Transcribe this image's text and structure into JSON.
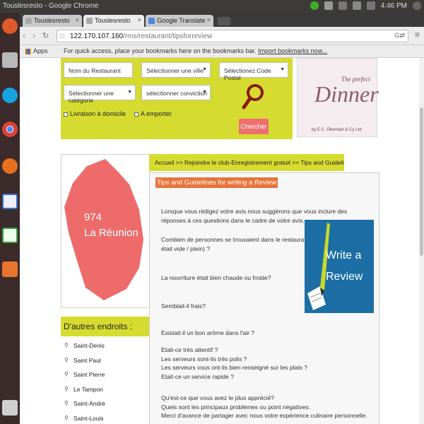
{
  "os": {
    "window_title": "Touslesresto - Google Chrome",
    "time": "4:46 PM",
    "user": "Person 1"
  },
  "launcher": {
    "items": [
      "ubuntu-dash-icon",
      "files-icon",
      "skype-icon",
      "chrome-icon",
      "firefox-icon",
      "writer-icon",
      "calc-icon",
      "software-center-icon",
      "trash-icon"
    ]
  },
  "tabs": [
    {
      "label": "Touslesresto",
      "close": "×"
    },
    {
      "label": "Touslesresto",
      "close": "×"
    },
    {
      "label": "Google Translate",
      "close": "×"
    }
  ],
  "address": {
    "host": "122.170.107.160",
    "path": "/rms/restaurant/tipsforreview"
  },
  "bookmarks": {
    "apps": "Apps",
    "hint": "For quick access, place your bookmarks here on the bookmarks bar.",
    "import": "Import bookmarks now..."
  },
  "search": {
    "restaurant_name": "Nom du Restaurant",
    "city": "Sélectionner une ville",
    "postal": "Sélectionez Code Postal",
    "category": "Sélectionner une catégorie",
    "conviction": "sélectionner conviction",
    "delivery": "Livraison à domicile",
    "takeaway": "A emporter",
    "button": "Chercher"
  },
  "ad": {
    "line1": "The perfect",
    "line2": "Dinner",
    "line3": "by E.C. Okenhan & Cy Ltd."
  },
  "map": {
    "number": "974",
    "name": "La Réunion",
    "fill": "#ee6b6b"
  },
  "places": {
    "heading": "D'autres endroits :",
    "items": [
      "Saint-Denis",
      "Saint Paul",
      "Saint Pierre",
      "Le Tampon",
      "Saint-André",
      "Saint-Louis"
    ]
  },
  "breadcrumb": "Accueil >> Rejoindre le club-Enregistrement gratuit >> Tips and Guidelines for writing ...",
  "content": {
    "title": "Tips and Guidelines for writing a Review",
    "intro": [
      "Lorsque vous rédigez votre avis nous suggérons que vous inclure des",
      "réponses à ces questions dans le cadre de votre avis."
    ],
    "q1": [
      "Combien de personnes se trouvaient dans le restaurant (Le restaurant",
      "était vide / plein) ?"
    ],
    "q2": "La nourriture était bien chaude ou froide?",
    "q3": "Semblait-il frais?",
    "q4": "Existait-il un bon arôme dans l'air ?",
    "q5": [
      "Etait-ce très attentif ?",
      "Les serveurs sont-ils très polis ?",
      "Les serveurs vous ont-ils bien renseigné sur les plats ?",
      "Etait-ce un service rapide ?"
    ],
    "q6": [
      "Qu'est-ce que vous avez le plus apprécié?",
      "Quels sont les principaux problèmes ou point négatives:",
      "Merci d'avance de partager avec nous votre expérience culinaire personnelle."
    ],
    "badge_line1": "Write a",
    "badge_line2": "Review"
  },
  "colors": {
    "lime": "#d5dc2f",
    "accent": "#e8743b",
    "badge": "#1c6ea4"
  }
}
